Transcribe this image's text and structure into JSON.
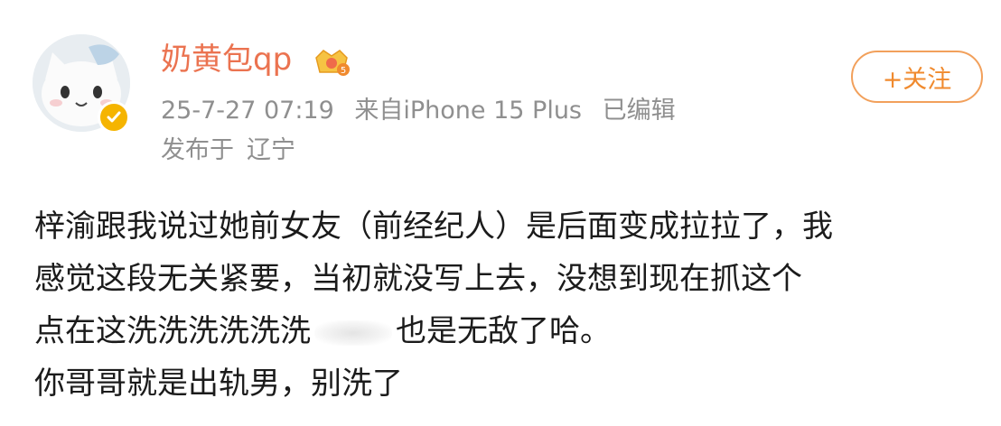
{
  "post": {
    "username": "奶黄包qp",
    "timestamp": "25-7-27 07:19",
    "source": "来自iPhone 15 Plus",
    "edited": "已编辑",
    "location_prefix": "发布于",
    "location": "辽宁",
    "follow_label": "+关注",
    "body": {
      "line1": "梓渝跟我说过她前女友（前经纪人）是后面变成拉拉了，我",
      "line2": "感觉这段无关紧要，当初就没写上去，没想到现在抓这个",
      "line3a": "点在这洗洗洗洗洗洗",
      "line3b": "也是无敌了哈。",
      "line4": "你哥哥就是出轨男，别洗了"
    }
  },
  "icons": {
    "avatar": "avatar-cat-image",
    "verified": "verified-badge-icon",
    "member": "crown-level-badge-icon"
  },
  "colors": {
    "username": "#eb7350",
    "meta": "#8f8f8f",
    "follow_border": "#f2a05b",
    "follow_text": "#f08a2e",
    "verified": "#f5b400"
  }
}
